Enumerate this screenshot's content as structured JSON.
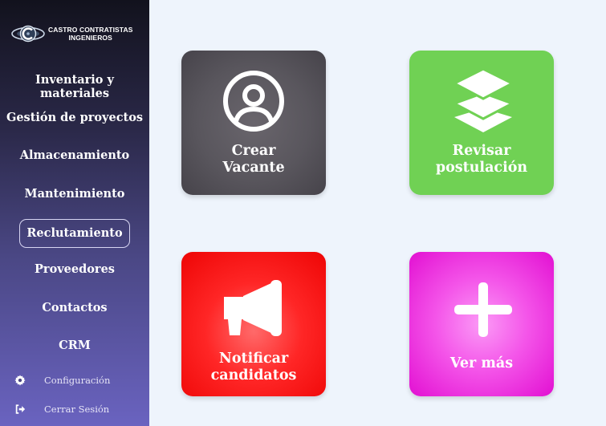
{
  "brand": {
    "line1": "CASTRO CONTRATISTAS",
    "line2": "INGENIEROS",
    "icon": "logo-eye-icon"
  },
  "sidebar": {
    "items": [
      {
        "label": "Inventario y materiales",
        "active": false
      },
      {
        "label": "Gestión de proyectos",
        "active": false
      },
      {
        "label": "Almacenamiento",
        "active": false
      },
      {
        "label": "Mantenimiento",
        "active": false
      },
      {
        "label": "Reclutamiento",
        "active": true
      },
      {
        "label": "Proveedores",
        "active": false
      },
      {
        "label": "Contactos",
        "active": false
      },
      {
        "label": "CRM",
        "active": false
      }
    ],
    "bottom": {
      "settings": {
        "label": "Configuración",
        "icon": "gear-icon"
      },
      "logout": {
        "label": "Cerrar Sesión",
        "icon": "sign-out-icon"
      }
    }
  },
  "cards": {
    "create": {
      "line1": "Crear",
      "line2": "Vacante",
      "icon": "user-circle-icon",
      "color": "#59565d"
    },
    "review": {
      "line1": "Revisar",
      "line2": "postulación",
      "icon": "layers-icon",
      "color": "#70d154"
    },
    "notify": {
      "line1": "Notificar",
      "line2": "candidatos",
      "icon": "megaphone-icon",
      "color": "#ff2626"
    },
    "more": {
      "label": "Ver más",
      "icon": "plus-icon",
      "color": "#f455e9"
    }
  },
  "colors": {
    "background": "#eef4fc",
    "sidebar_top": "#12121d",
    "sidebar_bottom": "#6a63c0"
  }
}
